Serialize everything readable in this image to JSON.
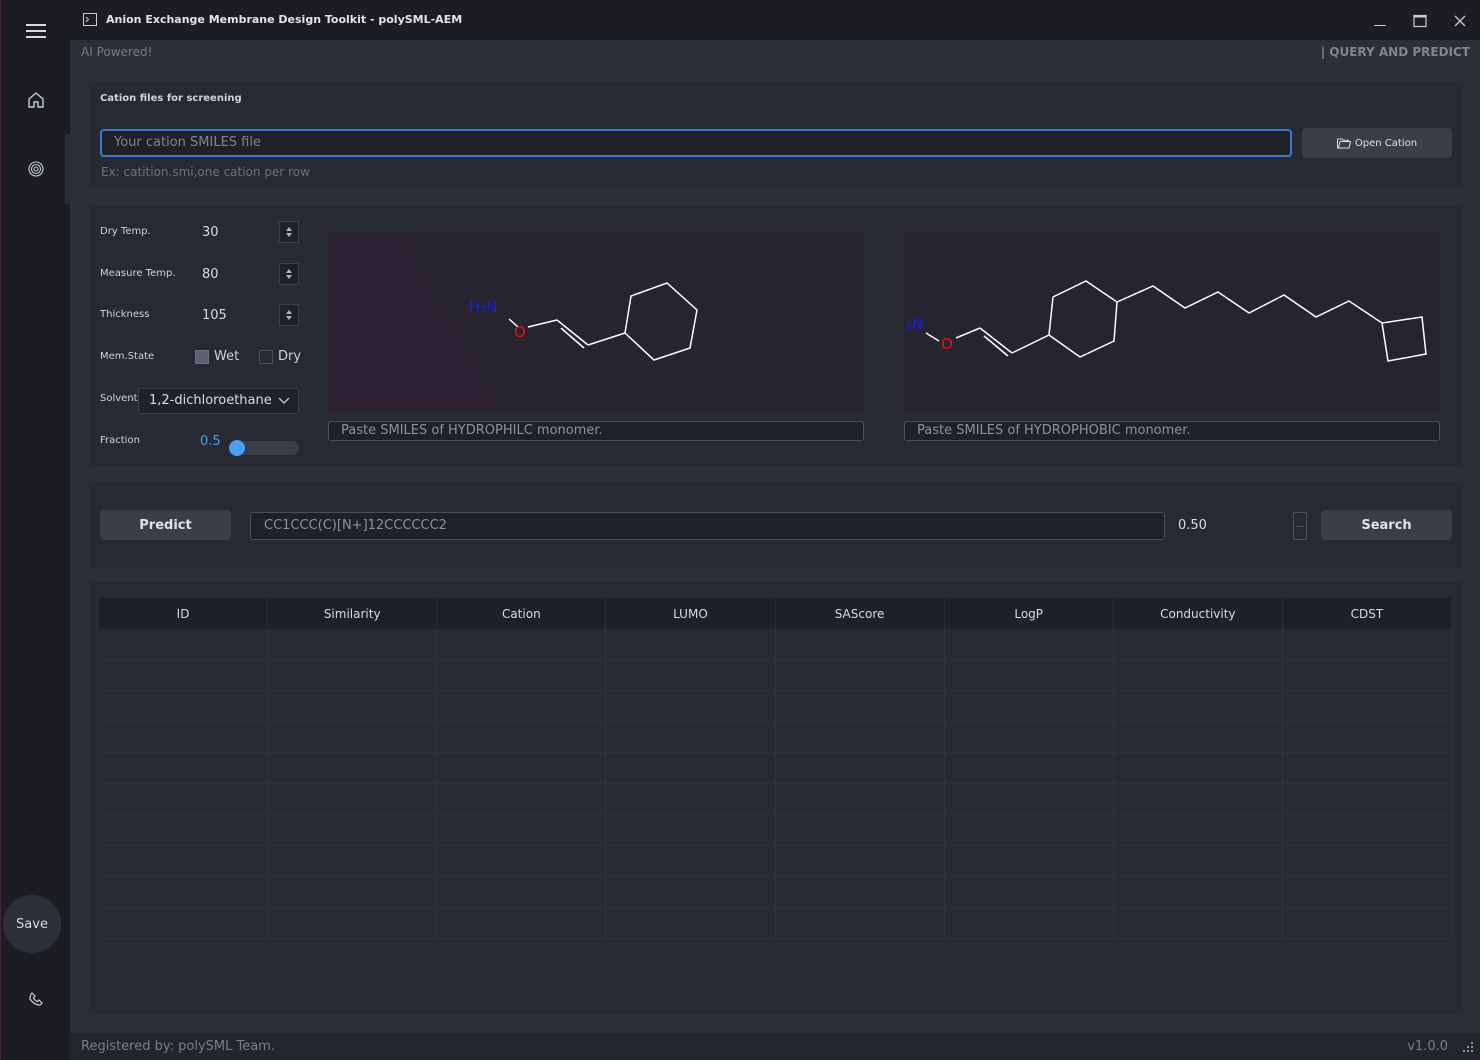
{
  "window": {
    "title": "Anion Exchange Membrane Design Toolkit - polySML-AEM"
  },
  "header": {
    "left_text": "AI Powered!",
    "right_text": "| QUERY AND PREDICT"
  },
  "sidebar": {
    "menu_icon": "hamburger-icon",
    "items": [
      {
        "icon": "home-icon"
      },
      {
        "icon": "fingerprint-icon"
      }
    ],
    "save_label": "Save",
    "phone_icon": "phone-icon"
  },
  "cation": {
    "section_title": "Cation files for screening",
    "placeholder": "Your cation SMILES file",
    "open_button": "Open Cation",
    "hint": "Ex: catition.smi,one cation per row"
  },
  "params": {
    "dry_temp_label": "Dry Temp.",
    "dry_temp_value": "30",
    "measure_temp_label": "Measure Temp.",
    "measure_temp_value": "80",
    "thickness_label": "Thickness",
    "thickness_value": "105",
    "mem_state_label": "Mem.State",
    "wet_label": "Wet",
    "dry_label": "Dry",
    "wet_checked": true,
    "dry_checked": false,
    "solvent_label": "Solvent",
    "solvent_value": "1,2-dichloroethane",
    "fraction_label": "Fraction",
    "fraction_value": "0.5",
    "fraction_level": 0.5
  },
  "monomers": {
    "hydrophilic_placeholder": "Paste SMILES of HYDROPHILC monomer.",
    "hydrophobic_placeholder": "Paste SMILES of HYDROPHOBIC monomer.",
    "hydrophilic_atoms": {
      "amine": "H₂N",
      "oxygen": "O"
    },
    "hydrophobic_atoms": {
      "amine": "₂N",
      "oxygen": "O"
    }
  },
  "predict": {
    "button": "Predict",
    "smiles_value": "CC1CCC(C)[N+]12CCCCCC2",
    "threshold_value": "0.50",
    "search_button": "Search"
  },
  "table": {
    "columns": [
      "ID",
      "Similarity",
      "Cation",
      "LUMO",
      "SAScore",
      "LogP",
      "Conductivity",
      "CDST"
    ],
    "rows": []
  },
  "status": {
    "left": "Registered by: polySML Team.",
    "version": "v1.0.0"
  },
  "colors": {
    "accent": "#4a9ff5",
    "focus_border": "#3c78d4",
    "amine": "#1d1dd8",
    "oxygen": "#e01818"
  }
}
